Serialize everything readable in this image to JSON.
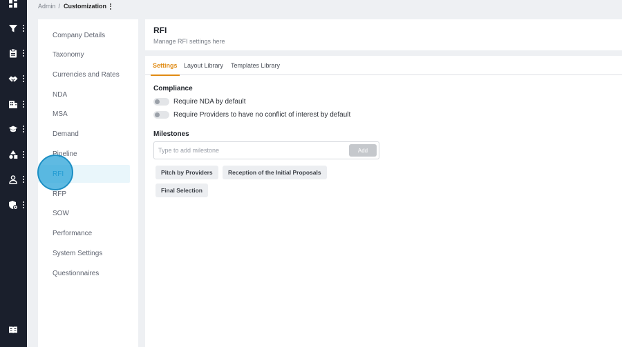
{
  "rail": {
    "items": [
      {
        "icon": "dashboard-icon"
      },
      {
        "icon": "filter-icon"
      },
      {
        "icon": "clipboard-icon"
      },
      {
        "icon": "handshake-icon"
      },
      {
        "icon": "building-icon"
      },
      {
        "icon": "graduation-cap-icon"
      },
      {
        "icon": "shapes-icon"
      },
      {
        "icon": "user-icon"
      },
      {
        "icon": "shield-settings-icon"
      }
    ],
    "bottom_icon": "book-icon"
  },
  "breadcrumb": {
    "root": "Admin",
    "separator": "/",
    "current": "Customization"
  },
  "settings_menu": {
    "items": [
      {
        "label": "Company Details"
      },
      {
        "label": "Taxonomy"
      },
      {
        "label": "Currencies and Rates"
      },
      {
        "label": "NDA"
      },
      {
        "label": "MSA"
      },
      {
        "label": "Demand"
      },
      {
        "label": "Pipeline"
      },
      {
        "label": "RFI"
      },
      {
        "label": "RFP"
      },
      {
        "label": "SOW"
      },
      {
        "label": "Performance"
      },
      {
        "label": "System Settings"
      },
      {
        "label": "Questionnaires"
      }
    ],
    "active": "RFI"
  },
  "header": {
    "title": "RFI",
    "subtitle": "Manage RFI settings here"
  },
  "tabs": [
    {
      "label": "Settings",
      "active": true
    },
    {
      "label": "Layout Library",
      "active": false
    },
    {
      "label": "Templates Library",
      "active": false
    }
  ],
  "compliance": {
    "title": "Compliance",
    "toggles": [
      {
        "label": "Require NDA by default",
        "on": false
      },
      {
        "label": "Require Providers to have no conflict of interest by default",
        "on": false
      }
    ]
  },
  "milestones": {
    "title": "Milestones",
    "input_placeholder": "Type to add milestone",
    "input_value": "",
    "add_label": "Add",
    "chips": [
      "Pitch by Providers",
      "Reception of the Initial Proposals",
      "Final Selection"
    ]
  },
  "colors": {
    "rail_bg": "#1a1f2c",
    "accent_orange": "#e08a12",
    "active_blue": "#1f8fc4",
    "click_highlight": "#21a0d7"
  }
}
